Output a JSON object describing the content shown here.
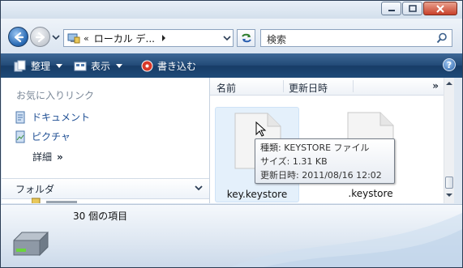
{
  "window": {
    "caption_buttons": [
      "minimize",
      "maximize",
      "close"
    ]
  },
  "address_bar": {
    "prefix": "«",
    "crumb": "ローカル デ...",
    "search_placeholder": "検索"
  },
  "toolbar": {
    "organize": "整理",
    "views": "表示",
    "burn": "書き込む",
    "help": "?"
  },
  "nav_pane": {
    "favorites_header": "お気に入りリンク",
    "links": [
      {
        "label": "ドキュメント",
        "icon": "documents-icon"
      },
      {
        "label": "ピクチャ",
        "icon": "pictures-icon"
      }
    ],
    "more_label": "詳細",
    "more_chevron": "»",
    "folders_label": "フォルダ"
  },
  "columns": {
    "name": "名前",
    "modified": "更新日時",
    "more": "»"
  },
  "files": [
    {
      "name": "key.keystore",
      "selected": true
    },
    {
      "name": ".keystore",
      "selected": false
    }
  ],
  "tooltip": {
    "type": "種類: KEYSTORE ファイル",
    "size": "サイズ: 1.31 KB",
    "modified": "更新日時: 2011/08/16 12:02"
  },
  "details": {
    "count": "30 個の項目"
  },
  "colors": {
    "toolbar": "#234b78",
    "link": "#1f4f94",
    "selection": "#e4f0fb"
  }
}
